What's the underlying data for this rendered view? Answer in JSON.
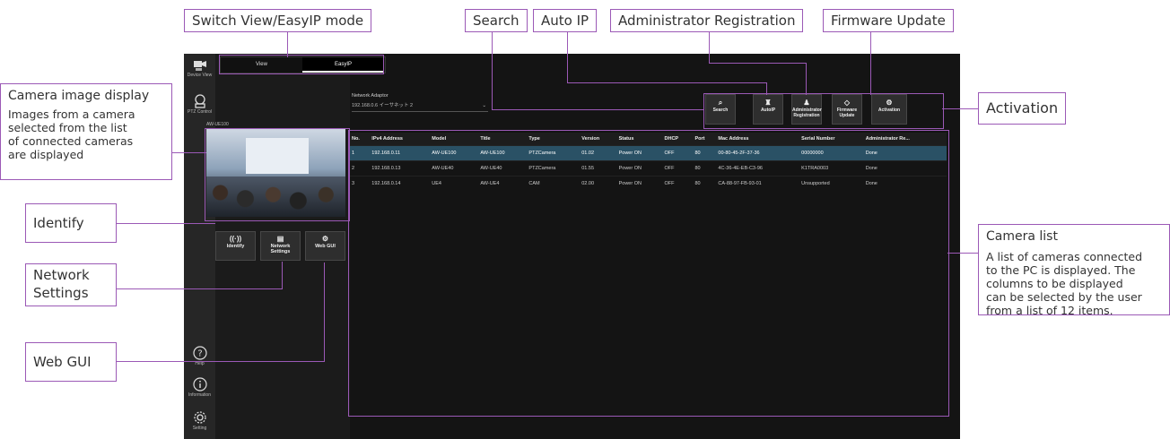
{
  "callouts": {
    "switch_mode": "Switch  View/EasyIP mode",
    "search": "Search",
    "auto_ip": "Auto IP",
    "admin_reg": "Administrator Registration",
    "firmware": "Firmware Update",
    "activation": "Activation",
    "camera_image": {
      "title": "Camera image display",
      "lines": [
        "Images from a camera",
        "selected from the list",
        "of connected cameras",
        "are displayed"
      ]
    },
    "identify": "Identify",
    "network_settings": [
      "Network",
      "Settings"
    ],
    "web_gui": "Web GUI",
    "camera_list": {
      "title": "Camera list",
      "lines": [
        "A list of cameras connected",
        "to the PC is displayed. The",
        "columns to be displayed",
        "can be selected by the user",
        "from a list of 12 items."
      ]
    }
  },
  "app": {
    "tabs": [
      "View",
      "EasyIP"
    ],
    "sidebar": [
      {
        "label": "Device View",
        "icon": "device-view-icon"
      },
      {
        "label": "PTZ Control",
        "icon": "ptz-control-icon"
      },
      {
        "label": "Help",
        "icon": "help-icon"
      },
      {
        "label": "Information",
        "icon": "information-icon"
      },
      {
        "label": "Setting",
        "icon": "setting-icon"
      }
    ],
    "network_adaptor_label": "Network Adaptor",
    "network_adaptor_value": "192.168.0.6  イーサネット 2",
    "camera_name": "AW-UE100",
    "panel_buttons": {
      "identify": "Identify",
      "network_settings": "Network Settings",
      "web_gui": "Web GUI"
    },
    "toolbar": {
      "search": "Search",
      "autoip": "AutoIP",
      "admin": "Administrator Registration",
      "firmware": "Firmware Update",
      "activation": "Activation"
    },
    "table": {
      "columns": [
        "No.",
        "IPv4 Address",
        "Model",
        "Title",
        "Type",
        "Version",
        "Status",
        "DHCP",
        "Port",
        "Mac Address",
        "Serial Number",
        "Administrator Re..."
      ],
      "rows": [
        [
          "1",
          "192.168.0.11",
          "AW-UE100",
          "AW-UE100",
          "PTZCamera",
          "01.02",
          "Power ON",
          "OFF",
          "80",
          "00-80-45-2F-37-36",
          "00000000",
          "Done"
        ],
        [
          "2",
          "192.168.0.13",
          "AW-UE40",
          "AW-UE40",
          "PTZCamera",
          "01.55",
          "Power ON",
          "OFF",
          "80",
          "4C-36-4E-EB-C3-96",
          "K1TRA0003",
          "Done"
        ],
        [
          "3",
          "192.168.0.14",
          "UE4",
          "AW-UE4",
          "CAM",
          "02.00",
          "Power ON",
          "OFF",
          "80",
          "CA-88-97-FB-93-01",
          "Unsupported",
          "Done"
        ]
      ]
    }
  },
  "colors": {
    "accent": "#9b59b6",
    "selected_row": "#2a5165",
    "app_bg": "#141414"
  }
}
